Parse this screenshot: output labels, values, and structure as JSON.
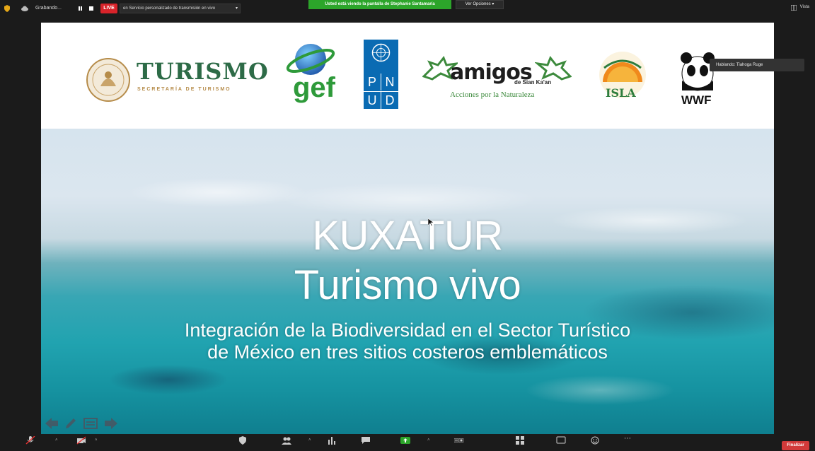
{
  "topbar": {
    "recording_label": "Grabando...",
    "live_badge": "LIVE",
    "stream_service": "en Servicio personalizado de transmisión en vivo",
    "share_banner": "Usted está viendo la pantalla de Stephanie Santamaría",
    "view_options": "Ver Opciones",
    "view_label": "Vista"
  },
  "slide": {
    "logos": {
      "turismo_name": "TURISMO",
      "turismo_sub": "SECRETARÍA DE TURISMO",
      "gef": "gef",
      "pnud": [
        "P",
        "N",
        "U",
        "D"
      ],
      "amigos_name": "amigos",
      "amigos_sub": "de Sian Ka'an",
      "amigos_tagline": "Acciones por la Naturaleza",
      "isla": "ISLA",
      "wwf": "WWF"
    },
    "title_line1": "KUXATUR",
    "title_line2": "Turismo vivo",
    "subtitle_line1": "Integración de la Biodiversidad en el Sector Turístico",
    "subtitle_line2": "de México en tres sitios costeros emblemáticos"
  },
  "speaking_label": "Hablando: Tiahoga Ruge",
  "bottombar": {
    "end_button": "Finalizar"
  },
  "colors": {
    "live_red": "#d8232a",
    "share_green": "#2ca52a",
    "turismo_green": "#2d6b47",
    "pnud_blue": "#0a6bb3",
    "end_red": "#d23a3a"
  }
}
